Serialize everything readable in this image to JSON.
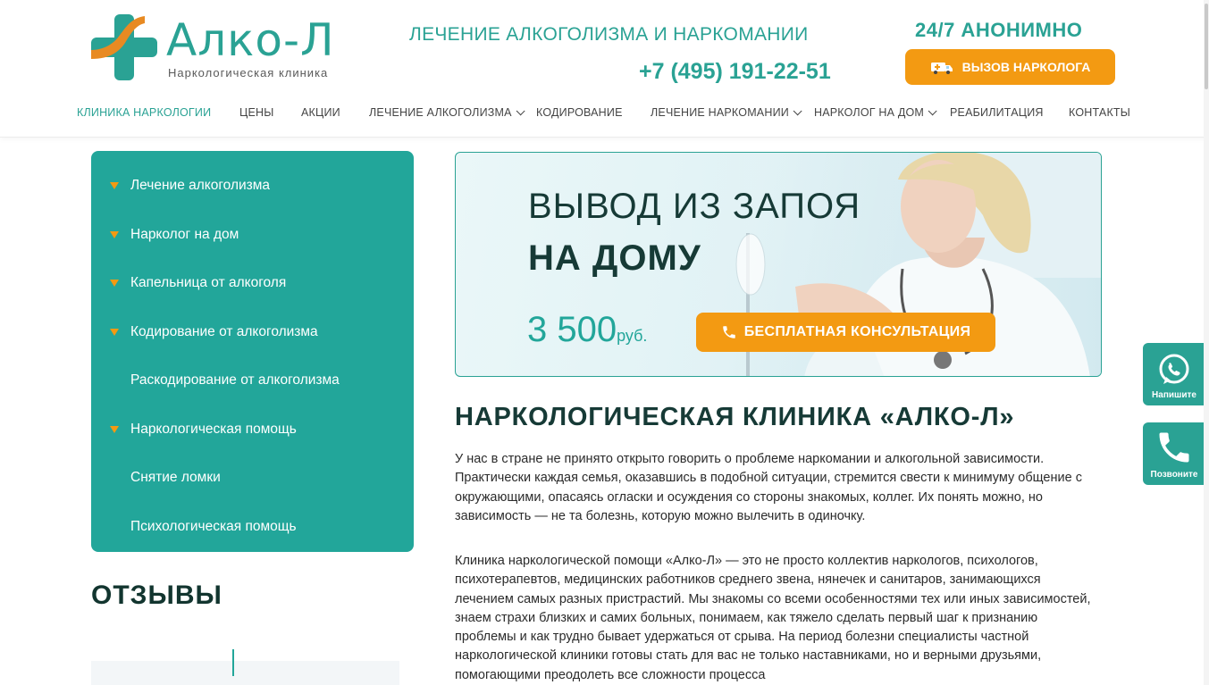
{
  "brand": {
    "name": "Алко-Л",
    "subtitle": "Наркологическая клиника",
    "colors": {
      "primary": "#2aa294",
      "accent": "#f39a12",
      "dark": "#163a36"
    }
  },
  "header": {
    "tagline": "ЛЕЧЕНИЕ АЛКОГОЛИЗМА И НАРКОМАНИИ",
    "phone": "+7 (495) 191-22-51",
    "availability": "24/7  АНОНИМНО",
    "call_button": "ВЫЗОВ НАРКОЛОГА",
    "call_button_icon": "ambulance-icon"
  },
  "nav": {
    "items": [
      {
        "label": "КЛИНИКА НАРКОЛОГИИ",
        "active": true
      },
      {
        "label": "ЦЕНЫ"
      },
      {
        "label": "АКЦИИ"
      },
      {
        "label": "ЛЕЧЕНИЕ АЛКОГОЛИЗМА",
        "dropdown": true
      },
      {
        "label": "КОДИРОВАНИЕ"
      },
      {
        "label": "ЛЕЧЕНИЕ НАРКОМАНИИ",
        "dropdown": true
      },
      {
        "label": "НАРКОЛОГ НА ДОМ",
        "dropdown": true
      },
      {
        "label": "РЕАБИЛИТАЦИЯ"
      },
      {
        "label": "КОНТАКТЫ"
      }
    ]
  },
  "sidebar": {
    "items": [
      {
        "label": "Лечение алкоголизма",
        "has_children": true
      },
      {
        "label": "Нарколог на дом",
        "has_children": true
      },
      {
        "label": "Капельница от алкоголя",
        "has_children": true
      },
      {
        "label": "Кодирование от алкоголизма",
        "has_children": true
      },
      {
        "label": "Раскодирование от алкоголизма",
        "has_children": false
      },
      {
        "label": "Наркологическая помощь",
        "has_children": true
      },
      {
        "label": "Снятие ломки",
        "has_children": false
      },
      {
        "label": "Психологическая помощь",
        "has_children": false
      }
    ]
  },
  "reviews": {
    "title": "ОТЗЫВЫ"
  },
  "banner": {
    "line1": "ВЫВОД ИЗ ЗАПОЯ",
    "line2": "НА ДОМУ",
    "price": "3 500",
    "currency": "руб.",
    "button": "БЕСПЛАТНАЯ КОНСУЛЬТАЦИЯ",
    "button_icon": "phone-icon"
  },
  "main": {
    "title": "НАРКОЛОГИЧЕСКАЯ КЛИНИКА «АЛКО-Л»",
    "paragraph1": "У нас в стране не принято открыто говорить о проблеме наркомании и алкогольной зависимости. Практически каждая семья, оказавшись в подобной ситуации, стремится свести к минимуму общение с окружающими, опасаясь огласки и осуждения со стороны знакомых, коллег. Их понять можно, но зависимость — не та болезнь, которую можно вылечить в одиночку.",
    "paragraph2": "Клиника наркологической помощи «Алко-Л» — это не просто коллектив наркологов, психологов, психотерапевтов, медицинских работников среднего звена, нянечек и санитаров, занимающихся лечением самых разных пристрастий. Мы знакомы со всеми особенностями тех или иных зависимостей, знаем страхи близких и самих больных, понимаем, как тяжело сделать первый шаг к признанию проблемы и как трудно бывает удержаться от срыва. На период болезни специалисты частной наркологической клиники готовы стать для вас не только наставниками, но и верными друзьями, помогающими преодолеть все сложности процесса"
  },
  "floating": {
    "whatsapp_label": "Напишите",
    "call_label": "Позвоните"
  }
}
